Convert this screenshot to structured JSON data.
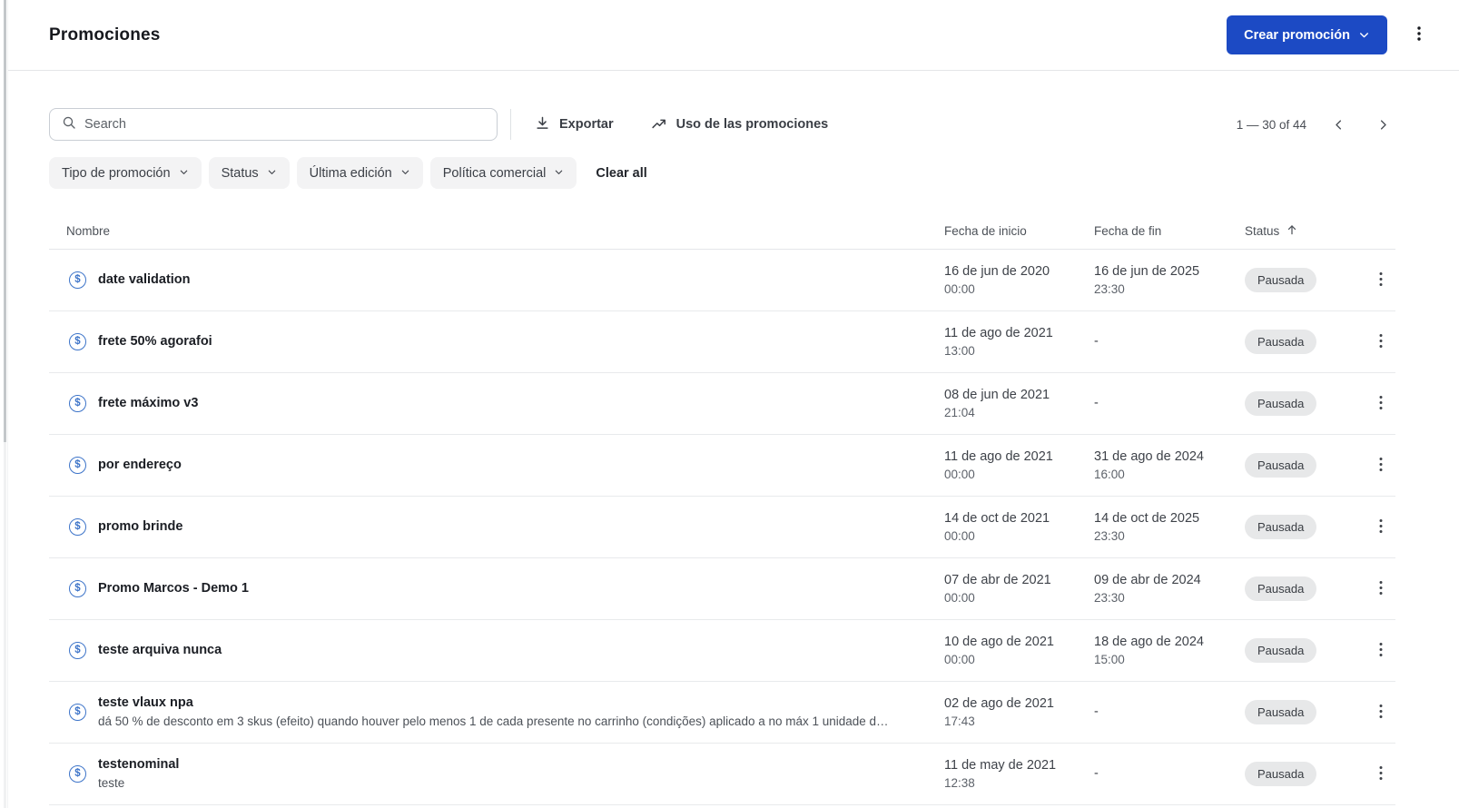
{
  "colors": {
    "primary": "#1c4ac4",
    "icon-blue": "#3d74c9",
    "badge-bg": "#e7e8e9"
  },
  "header": {
    "title": "Promociones",
    "create_button": "Crear promoción"
  },
  "toolbar": {
    "search_placeholder": "Search",
    "export_label": "Exportar",
    "usage_label": "Uso de las promociones",
    "pagination_range": "1 — 30 of 44"
  },
  "filters": {
    "chips": [
      {
        "label": "Tipo de promoción"
      },
      {
        "label": "Status"
      },
      {
        "label": "Última edición"
      },
      {
        "label": "Política comercial"
      }
    ],
    "clear_all": "Clear all"
  },
  "table": {
    "columns": {
      "name": "Nombre",
      "start": "Fecha de inicio",
      "end": "Fecha de fin",
      "status": "Status"
    },
    "rows": [
      {
        "name": "date validation",
        "description": "",
        "start_date": "16 de jun de 2020",
        "start_time": "00:00",
        "end_date": "16 de jun de 2025",
        "end_time": "23:30",
        "status": "Pausada"
      },
      {
        "name": "frete 50% agorafoi",
        "description": "",
        "start_date": "11 de ago de 2021",
        "start_time": "13:00",
        "end_date": "-",
        "end_time": "",
        "status": "Pausada"
      },
      {
        "name": "frete máximo v3",
        "description": "",
        "start_date": "08 de jun de 2021",
        "start_time": "21:04",
        "end_date": "-",
        "end_time": "",
        "status": "Pausada"
      },
      {
        "name": "por endereço",
        "description": "",
        "start_date": "11 de ago de 2021",
        "start_time": "00:00",
        "end_date": "31 de ago de 2024",
        "end_time": "16:00",
        "status": "Pausada"
      },
      {
        "name": "promo brinde",
        "description": "",
        "start_date": "14 de oct de 2021",
        "start_time": "00:00",
        "end_date": "14 de oct de 2025",
        "end_time": "23:30",
        "status": "Pausada"
      },
      {
        "name": "Promo Marcos - Demo 1",
        "description": "",
        "start_date": "07 de abr de 2021",
        "start_time": "00:00",
        "end_date": "09 de abr de 2024",
        "end_time": "23:30",
        "status": "Pausada"
      },
      {
        "name": "teste arquiva nunca",
        "description": "",
        "start_date": "10 de ago de 2021",
        "start_time": "00:00",
        "end_date": "18 de ago de 2024",
        "end_time": "15:00",
        "status": "Pausada"
      },
      {
        "name": "teste vlaux npa",
        "description": "dá 50 % de desconto em 3 skus (efeito) quando houver pelo menos 1 de cada presente no carrinho (condições) aplicado a no máx 1 unidade d…",
        "start_date": "02 de ago de 2021",
        "start_time": "17:43",
        "end_date": "-",
        "end_time": "",
        "status": "Pausada"
      },
      {
        "name": "testenominal",
        "description": "teste",
        "start_date": "11 de may de 2021",
        "start_time": "12:38",
        "end_date": "-",
        "end_time": "",
        "status": "Pausada"
      }
    ]
  }
}
